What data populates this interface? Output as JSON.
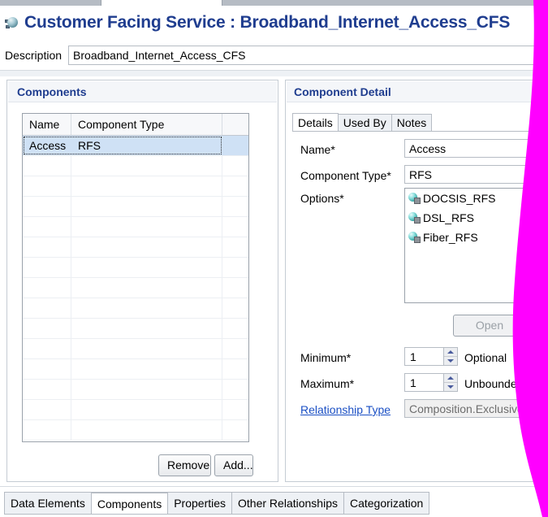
{
  "header": {
    "icon": "service-globe-icon",
    "title": "Customer Facing Service : Broadband_Internet_Access_CFS"
  },
  "description": {
    "label": "Description",
    "value": "Broadband_Internet_Access_CFS",
    "placeholder": ""
  },
  "components_panel": {
    "title": "Components",
    "table": {
      "columns": [
        "Name",
        "Component Type",
        ""
      ],
      "rows": [
        {
          "name": "Access",
          "type": "RFS",
          "selected": true
        },
        {
          "name": "",
          "type": "",
          "selected": false
        },
        {
          "name": "",
          "type": "",
          "selected": false
        },
        {
          "name": "",
          "type": "",
          "selected": false
        },
        {
          "name": "",
          "type": "",
          "selected": false
        },
        {
          "name": "",
          "type": "",
          "selected": false
        },
        {
          "name": "",
          "type": "",
          "selected": false
        },
        {
          "name": "",
          "type": "",
          "selected": false
        },
        {
          "name": "",
          "type": "",
          "selected": false
        },
        {
          "name": "",
          "type": "",
          "selected": false
        },
        {
          "name": "",
          "type": "",
          "selected": false
        },
        {
          "name": "",
          "type": "",
          "selected": false
        },
        {
          "name": "",
          "type": "",
          "selected": false
        },
        {
          "name": "",
          "type": "",
          "selected": false
        },
        {
          "name": "",
          "type": "",
          "selected": false
        }
      ]
    },
    "remove_label": "Remove",
    "add_label": "Add..."
  },
  "detail_panel": {
    "title": "Component Detail",
    "tabs": [
      {
        "label": "Details",
        "active": true
      },
      {
        "label": "Used By",
        "active": false
      },
      {
        "label": "Notes",
        "active": false
      }
    ],
    "fields": {
      "name_label": "Name*",
      "name_value": "Access",
      "component_type_label": "Component Type*",
      "component_type_value": "RFS",
      "options_label": "Options*",
      "options": [
        {
          "icon": "rfs-node-icon",
          "label": "DOCSIS_RFS"
        },
        {
          "icon": "rfs-node-icon",
          "label": "DSL_RFS"
        },
        {
          "icon": "rfs-node-icon",
          "label": "Fiber_RFS"
        }
      ],
      "open_label": "Open",
      "open_disabled": true,
      "minimum_label": "Minimum*",
      "minimum_value": "1",
      "optional_label": "Optional",
      "maximum_label": "Maximum*",
      "maximum_value": "1",
      "unbounded_label": "Unbounded",
      "relationship_type_label": "Relationship Type",
      "relationship_type_value": "Composition.Exclusive"
    }
  },
  "bottom_tabs": [
    {
      "label": "Data Elements",
      "active": false
    },
    {
      "label": "Components",
      "active": true
    },
    {
      "label": "Properties",
      "active": false
    },
    {
      "label": "Other Relationships",
      "active": false
    },
    {
      "label": "Categorization",
      "active": false
    }
  ],
  "overlay": {
    "name": "magenta-wedge",
    "color": "#FF00FF"
  }
}
